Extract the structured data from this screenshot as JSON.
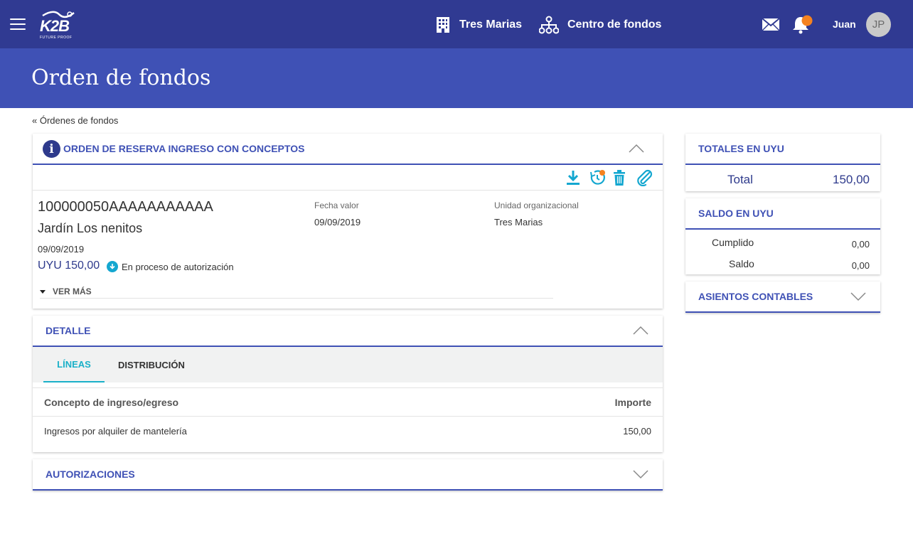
{
  "app": {
    "logo_text": "K2B",
    "logo_tagline": "FUTURE PROOF",
    "nav": [
      {
        "label": "Tres Marias",
        "icon": "building-icon"
      },
      {
        "label": "Centro de fondos",
        "icon": "hierarchy-icon"
      }
    ],
    "user_name": "Juan",
    "avatar_initials": "JP",
    "notification_color": "#f5821f"
  },
  "page": {
    "title": "Orden de fondos",
    "breadcrumb": "« Órdenes de fondos"
  },
  "order": {
    "header": "ORDEN DE RESERVA INGRESO CON CONCEPTOS",
    "number": "100000050AAAAAAAAAAA",
    "name": "Jardín Los nenitos",
    "date": "09/09/2019",
    "amount": "UYU 150,00",
    "status": "En proceso de autorización",
    "ver_mas": "VER MÁS",
    "fecha_valor_label": "Fecha valor",
    "fecha_valor": "09/09/2019",
    "unidad_label": "Unidad organizacional",
    "unidad": "Tres Marias",
    "toolbar": [
      "download-icon",
      "history-icon",
      "trash-icon",
      "attach-icon"
    ]
  },
  "detalle": {
    "header": "DETALLE",
    "tabs": [
      {
        "label": "LÍNEAS",
        "active": true
      },
      {
        "label": "DISTRIBUCIÓN",
        "active": false
      }
    ],
    "columns": [
      "Concepto de ingreso/egreso",
      "Importe"
    ],
    "rows": [
      {
        "concepto": "Ingresos por alquiler de mantelería",
        "importe": "150,00"
      }
    ]
  },
  "autorizaciones": {
    "header": "AUTORIZACIONES"
  },
  "totales": {
    "header": "TOTALES EN UYU",
    "label": "Total",
    "value": "150,00"
  },
  "saldo": {
    "header": "SALDO EN UYU",
    "rows": [
      {
        "label": "Cumplido",
        "value": "0,00"
      },
      {
        "label": "Saldo",
        "value": "0,00"
      }
    ]
  },
  "asientos": {
    "header": "ASIENTOS CONTABLES"
  },
  "colors": {
    "topbar": "#303a92",
    "title_band": "#3f51b5",
    "accent": "#3f51b5",
    "tab_active": "#1ab0c8",
    "tool_icons": "#14a7d0"
  }
}
